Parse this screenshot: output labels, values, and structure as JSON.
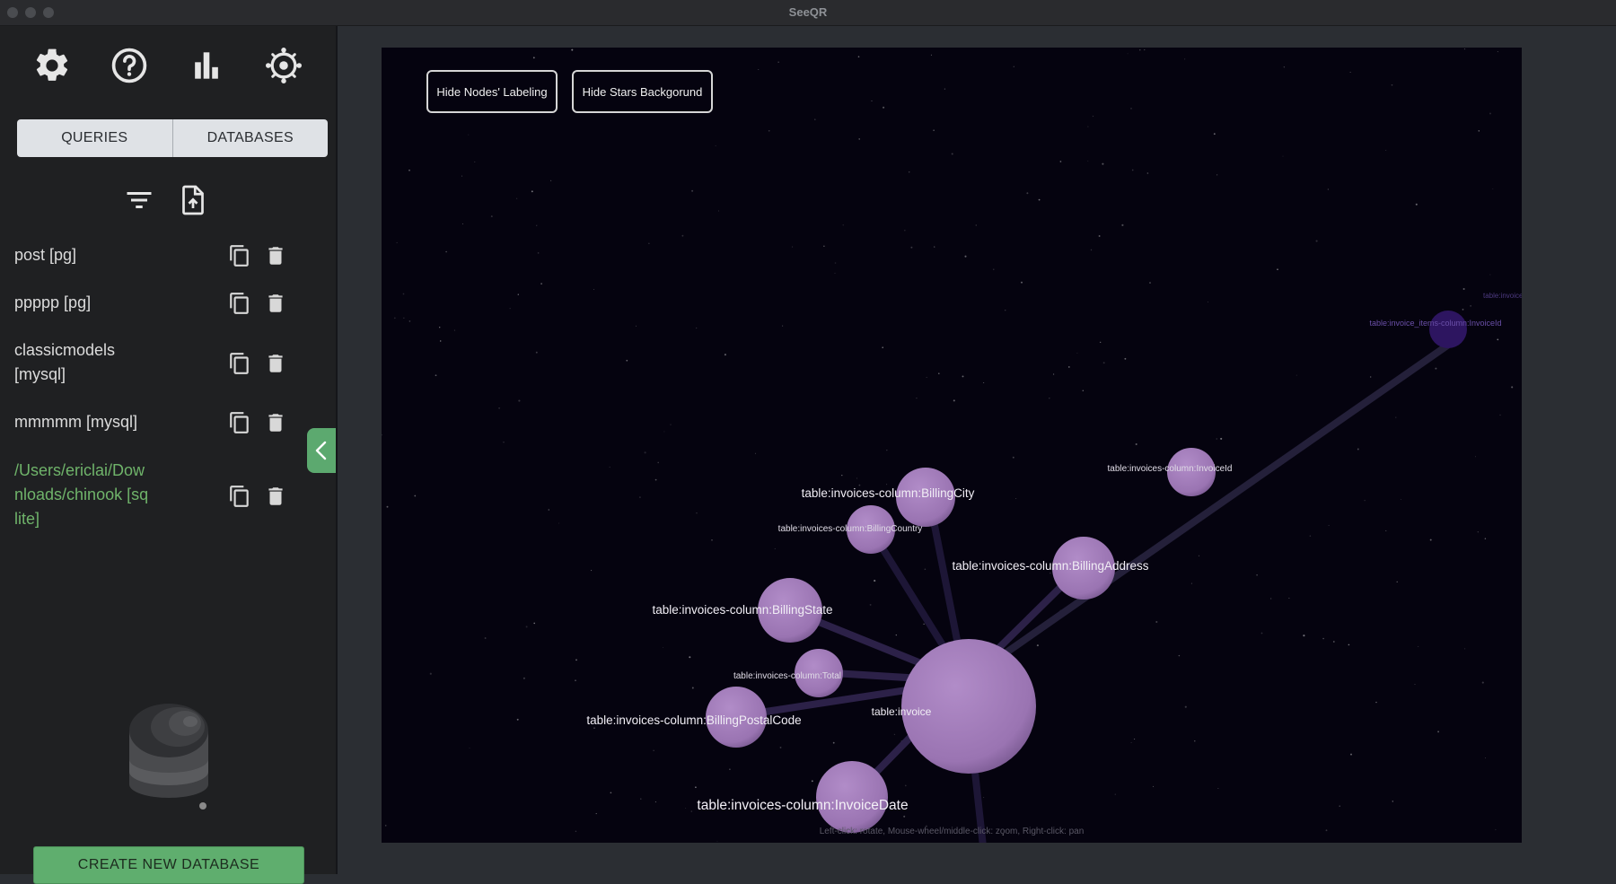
{
  "window": {
    "title": "SeeQR"
  },
  "toolbar": {
    "icons": [
      "gear-icon",
      "help-icon",
      "bar-chart-icon",
      "settings-wheel-icon"
    ]
  },
  "tabs": [
    {
      "label": "QUERIES"
    },
    {
      "label": "DATABASES"
    }
  ],
  "tools": {
    "icons": [
      "filter-icon",
      "file-upload-icon"
    ]
  },
  "databases": [
    {
      "label": "post [pg]",
      "selected": false
    },
    {
      "label": "ppppp [pg]",
      "selected": false
    },
    {
      "label": "classicmodels [mysql]",
      "selected": false
    },
    {
      "label": "mmmmm [mysql]",
      "selected": false
    },
    {
      "label": "/Users/ericlai/Downloads/chinook [sqlite]",
      "selected": true
    }
  ],
  "create_button": {
    "label": "CREATE NEW DATABASE"
  },
  "graph": {
    "buttons": {
      "hide_labels": "Hide Nodes' Labeling",
      "hide_stars": "Hide Stars Backgorund"
    },
    "hint": "Left-click: rotate, Mouse-wheel/middle-click: zoom, Right-click: pan",
    "nodes": [
      {
        "id": "invoice",
        "label": "table:invoice",
        "kind": "table"
      },
      {
        "id": "billing_city",
        "label": "table:invoices-column:BillingCity",
        "kind": "column"
      },
      {
        "id": "billing_country",
        "label": "table:invoices-column:BillingCountry",
        "kind": "column"
      },
      {
        "id": "billing_address",
        "label": "table:invoices-column:BillingAddress",
        "kind": "column"
      },
      {
        "id": "billing_state",
        "label": "table:invoices-column:BillingState",
        "kind": "column"
      },
      {
        "id": "total",
        "label": "table:invoices-column:Total",
        "kind": "column"
      },
      {
        "id": "billing_postal",
        "label": "table:invoices-column:BillingPostalCode",
        "kind": "column"
      },
      {
        "id": "invoice_date",
        "label": "table:invoices-column:InvoiceDate",
        "kind": "column"
      },
      {
        "id": "invoice_id",
        "label": "table:invoices-column:InvoiceId",
        "kind": "column"
      },
      {
        "id": "items_invoice_id",
        "label": "table:invoice_items-column:InvoiceId",
        "kind": "foreign-column"
      },
      {
        "id": "invoice_items_partial",
        "label": "table:invoice_i",
        "kind": "foreign-column"
      }
    ],
    "colors": {
      "node": "#a57fbb",
      "foreign_node": "#3a1e6a",
      "background": "#05030f"
    }
  }
}
